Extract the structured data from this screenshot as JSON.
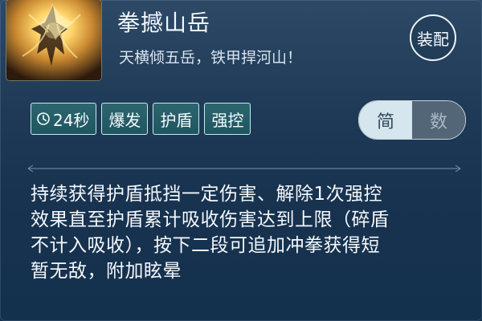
{
  "skill": {
    "title": "拳撼山岳",
    "quote": "天横倾五岳，铁甲捍河山！",
    "equip_label": "装配"
  },
  "tags": [
    {
      "label": "24秒",
      "icon": "timer-icon"
    },
    {
      "label": "爆发"
    },
    {
      "label": "护盾"
    },
    {
      "label": "强控"
    }
  ],
  "toggle": {
    "simple_label": "简",
    "number_label": "数",
    "selected": "简"
  },
  "description": "持续获得护盾抵挡一定伤害、解除1次强控\n效果直至护盾累计吸收伤害达到上限（碎盾\n不计入吸收），按下二段可追加冲拳获得短\n暂无敌，附加眩晕",
  "colors": {
    "panel_top": "#2d4966",
    "panel_bottom": "#13304c",
    "tag_fill": "#2d6670",
    "tag_border": "#bfeeea",
    "toggle_active": "#d6e6ee",
    "portrait_glow": "#e6b84e"
  }
}
